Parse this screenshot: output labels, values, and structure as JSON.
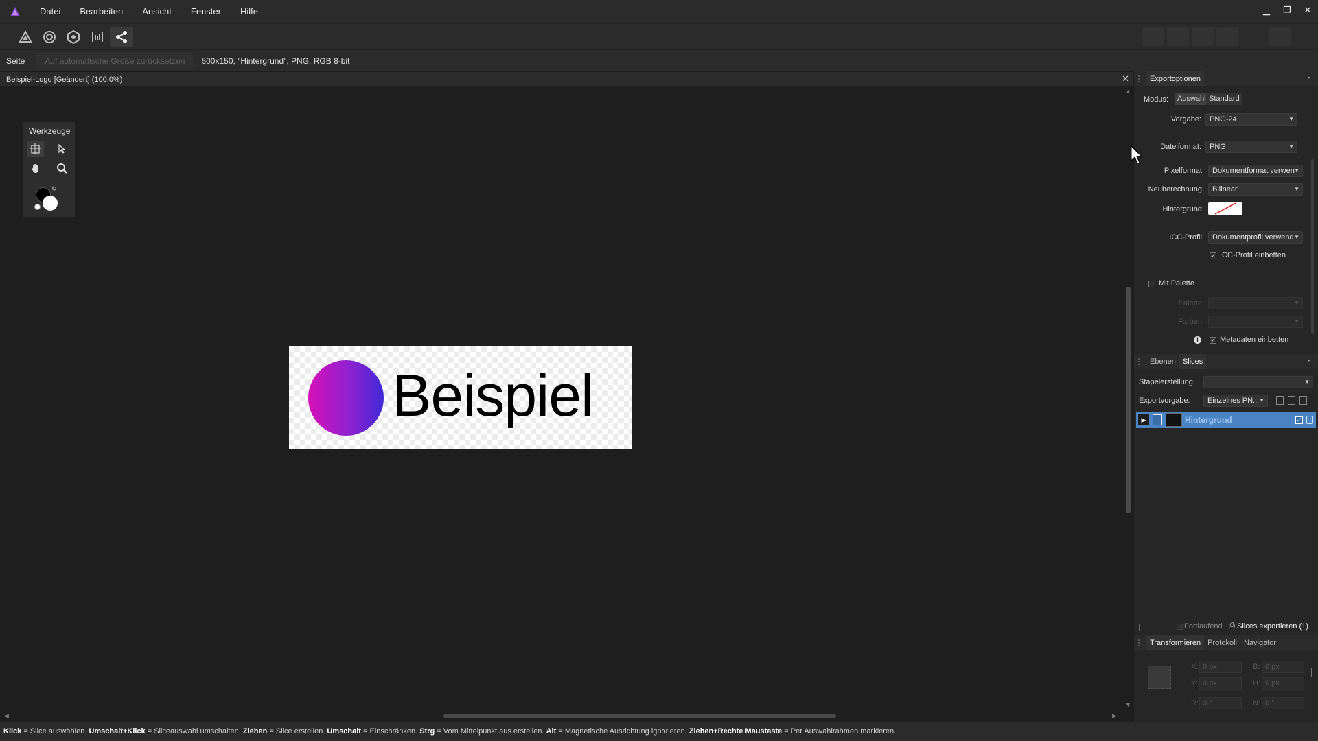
{
  "menu": {
    "items": [
      "Datei",
      "Bearbeiten",
      "Ansicht",
      "Fenster",
      "Hilfe"
    ]
  },
  "context_bar": {
    "page_label": "Seite",
    "reset_label": "Auf automatische Größe zurücksetzen",
    "info": "500x150, \"Hintergrund\", PNG, RGB 8-bit"
  },
  "document": {
    "title": "Beispiel-Logo [Geändert] (100.0%)",
    "artwork_text": "Beispiel"
  },
  "tools": {
    "title": "Werkzeuge"
  },
  "export_panel": {
    "tab": "Exportoptionen",
    "mode_label": "Modus:",
    "mode_options": [
      "Auswahl",
      "Standard"
    ],
    "preset_label": "Vorgabe:",
    "preset_value": "PNG-24",
    "format_label": "Dateiformat:",
    "format_value": "PNG",
    "pixel_label": "Pixelformat:",
    "pixel_value": "Dokumentformat verwen",
    "resample_label": "Neuberechnung:",
    "resample_value": "Bilinear",
    "background_label": "Hintergrund:",
    "icc_label": "ICC-Profil:",
    "icc_value": "Dokumentprofil verwend",
    "embed_icc_label": "ICC-Profil einbetten",
    "palette_label": "Mit Palette",
    "palette_sub1": "Palette:",
    "palette_sub2": "Farben:",
    "metadata_label": "Metadaten einbetten"
  },
  "slices_panel": {
    "tabs": [
      "Ebenen",
      "Slices"
    ],
    "batch_label": "Stapelerstellung:",
    "batch_value": "",
    "preset_label": "Exportvorgabe:",
    "preset_value": "Einzelnes PN...",
    "slice_name": "Hintergrund",
    "continuous_label": "Fortlaufend",
    "export_label": "Slices exportieren (1)"
  },
  "transform_panel": {
    "tabs": [
      "Transformieren",
      "Protokoll",
      "Navigator"
    ],
    "x_label": "X:",
    "x_value": "0 px",
    "y_label": "Y:",
    "y_value": "0 px",
    "w_label": "B:",
    "w_value": "0 px",
    "h_label": "H:",
    "h_value": "0 px",
    "r_label": "R:",
    "r_value": "0 °",
    "s_label": "N:",
    "s_value": "0 °"
  },
  "status": {
    "k1": "Klick",
    "t1": " = Slice auswählen. ",
    "k2": "Umschalt+Klick",
    "t2": " = Sliceauswahl umschalten. ",
    "k3": "Ziehen",
    "t3": " = Slice erstellen. ",
    "k4": "Umschalt",
    "t4": " = Einschränken. ",
    "k5": "Strg",
    "t5": " = Vom Mittelpunkt aus erstellen. ",
    "k6": "Alt",
    "t6": " = Magnetische Ausrichtung ignorieren. ",
    "k7": "Ziehen+Rechte Maustaste",
    "t7": " = Per Auswahlrahmen markieren."
  },
  "colors": {
    "accent": "#4a84c4",
    "logo_gradient_start": "#d610b8",
    "logo_gradient_end": "#4129d6"
  }
}
